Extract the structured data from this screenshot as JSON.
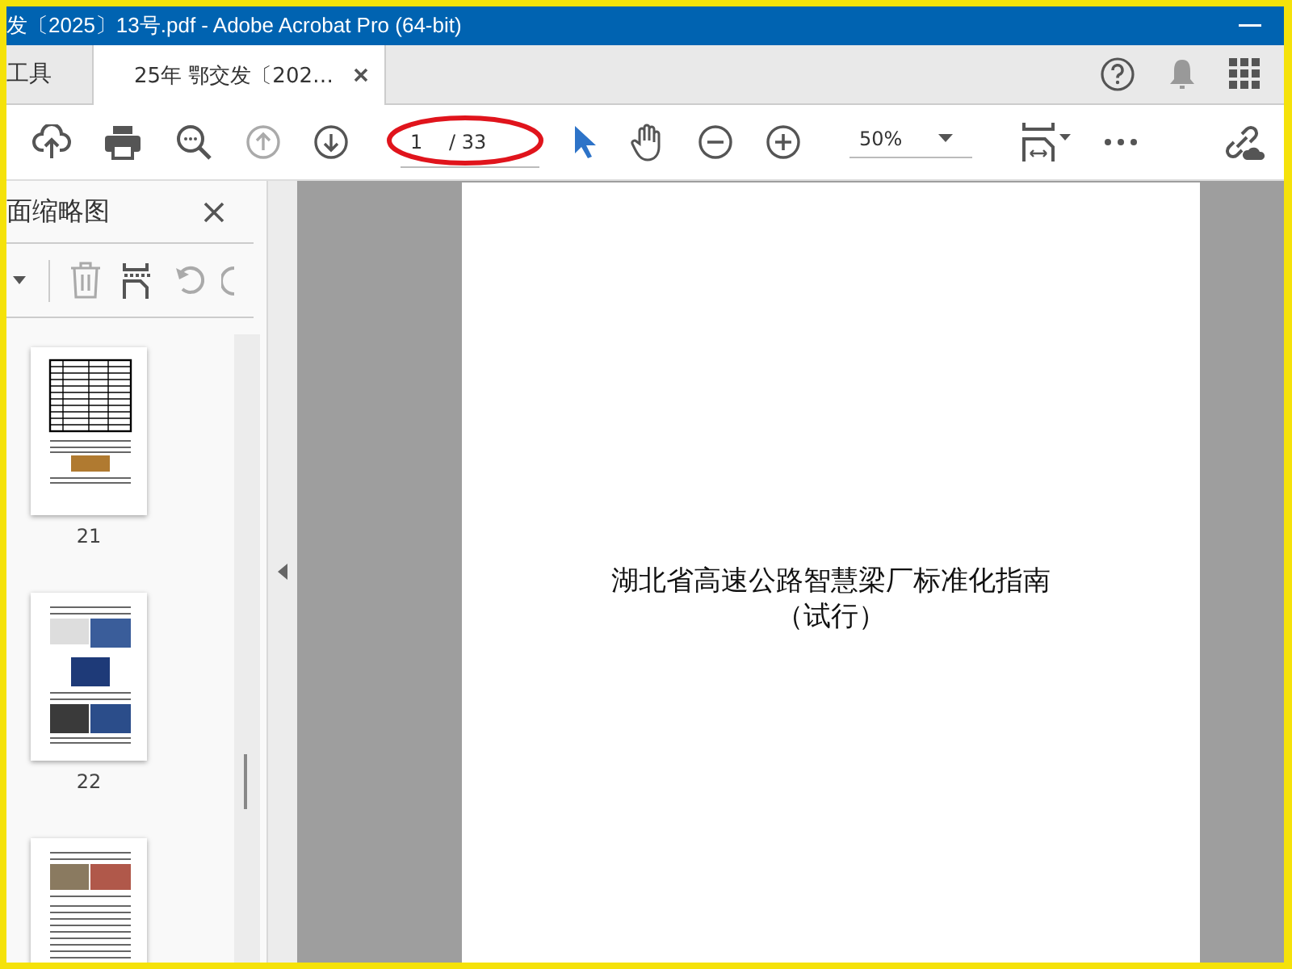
{
  "window": {
    "title": "发〔2025〕13号.pdf - Adobe Acrobat Pro (64-bit)"
  },
  "tabs": [
    {
      "label": "工具",
      "selected": false,
      "closable": false
    },
    {
      "label": "25年 鄂交发〔202…",
      "selected": true,
      "closable": true
    }
  ],
  "toolbar": {
    "page_field": {
      "value": "1",
      "total": "/ 33"
    },
    "zoom": {
      "value": "50%"
    }
  },
  "thumbnails_panel": {
    "title": "面缩略图",
    "pages": [
      {
        "label": "21",
        "kind": "table"
      },
      {
        "label": "22",
        "kind": "photos"
      },
      {
        "kind": "text"
      }
    ]
  },
  "document": {
    "title_lines": [
      "湖北省高速公路智慧梁厂标准化指南",
      "（试行）"
    ]
  }
}
